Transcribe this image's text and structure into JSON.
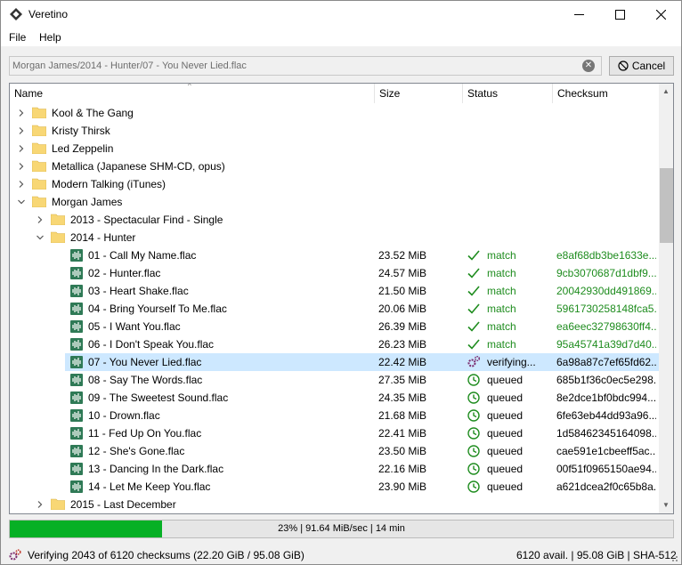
{
  "window": {
    "title": "Veretino"
  },
  "menu": {
    "file": "File",
    "help": "Help"
  },
  "path_bar": {
    "value": "Morgan James/2014 - Hunter/07 - You Never Lied.flac"
  },
  "cancel_button": {
    "label": "Cancel"
  },
  "columns": {
    "name": "Name",
    "size": "Size",
    "status": "Status",
    "checksum": "Checksum"
  },
  "tree_rows": [
    {
      "kind": "folder",
      "level": 0,
      "expander": "collapsed",
      "name": "Kool & The Gang"
    },
    {
      "kind": "folder",
      "level": 0,
      "expander": "collapsed",
      "name": "Kristy Thirsk"
    },
    {
      "kind": "folder",
      "level": 0,
      "expander": "collapsed",
      "name": "Led Zeppelin"
    },
    {
      "kind": "folder",
      "level": 0,
      "expander": "collapsed",
      "name": "Metallica (Japanese SHM-CD, opus)"
    },
    {
      "kind": "folder",
      "level": 0,
      "expander": "collapsed",
      "name": "Modern Talking (iTunes)"
    },
    {
      "kind": "folder",
      "level": 0,
      "expander": "expanded",
      "name": "Morgan James"
    },
    {
      "kind": "folder",
      "level": 1,
      "expander": "collapsed",
      "name": "2013 - Spectacular Find - Single"
    },
    {
      "kind": "folder",
      "level": 1,
      "expander": "expanded",
      "name": "2014 - Hunter"
    },
    {
      "kind": "file",
      "level": 2,
      "name": "01 - Call My Name.flac",
      "size": "23.52 MiB",
      "status": "match",
      "checksum": "e8af68db3be1633e..."
    },
    {
      "kind": "file",
      "level": 2,
      "name": "02 - Hunter.flac",
      "size": "24.57 MiB",
      "status": "match",
      "checksum": "9cb3070687d1dbf9..."
    },
    {
      "kind": "file",
      "level": 2,
      "name": "03 - Heart Shake.flac",
      "size": "21.50 MiB",
      "status": "match",
      "checksum": "20042930dd491869..."
    },
    {
      "kind": "file",
      "level": 2,
      "name": "04 - Bring Yourself To Me.flac",
      "size": "20.06 MiB",
      "status": "match",
      "checksum": "5961730258148fca5..."
    },
    {
      "kind": "file",
      "level": 2,
      "name": "05 - I Want You.flac",
      "size": "26.39 MiB",
      "status": "match",
      "checksum": "ea6eec32798630ff4..."
    },
    {
      "kind": "file",
      "level": 2,
      "name": "06 - I Don't Speak You.flac",
      "size": "26.23 MiB",
      "status": "match",
      "checksum": "95a45741a39d7d40..."
    },
    {
      "kind": "file",
      "level": 2,
      "name": "07 - You Never Lied.flac",
      "size": "22.42 MiB",
      "status": "verifying...",
      "checksum": "6a98a87c7ef65fd62...",
      "selected": true
    },
    {
      "kind": "file",
      "level": 2,
      "name": "08 - Say The Words.flac",
      "size": "27.35 MiB",
      "status": "queued",
      "checksum": "685b1f36c0ec5e298..."
    },
    {
      "kind": "file",
      "level": 2,
      "name": "09 - The Sweetest Sound.flac",
      "size": "24.35 MiB",
      "status": "queued",
      "checksum": "8e2dce1bf0bdc994..."
    },
    {
      "kind": "file",
      "level": 2,
      "name": "10 - Drown.flac",
      "size": "21.68 MiB",
      "status": "queued",
      "checksum": "6fe63eb44dd93a96..."
    },
    {
      "kind": "file",
      "level": 2,
      "name": "11 - Fed Up On You.flac",
      "size": "22.41 MiB",
      "status": "queued",
      "checksum": "1d58462345164098..."
    },
    {
      "kind": "file",
      "level": 2,
      "name": "12 - She's Gone.flac",
      "size": "23.50 MiB",
      "status": "queued",
      "checksum": "cae591e1cbeeff5ac..."
    },
    {
      "kind": "file",
      "level": 2,
      "name": "13 - Dancing In the Dark.flac",
      "size": "22.16 MiB",
      "status": "queued",
      "checksum": "00f51f0965150ae94..."
    },
    {
      "kind": "file",
      "level": 2,
      "name": "14 - Let Me Keep You.flac",
      "size": "23.90 MiB",
      "status": "queued",
      "checksum": "a621dcea2f0c65b8a..."
    },
    {
      "kind": "folder",
      "level": 1,
      "expander": "collapsed",
      "name": "2015 - Last December"
    }
  ],
  "progress": {
    "fraction": 0.23,
    "label": "23% | 91.64 MiB/sec | 14 min"
  },
  "statusbar": {
    "left": "Verifying 2043 of 6120 checksums (22.20 GiB / 95.08 GiB)",
    "right": "6120 avail. | 95.08 GiB | SHA-512"
  },
  "colors": {
    "match": "#1e8c1e",
    "progress": "#06b025",
    "selected": "#cde8ff",
    "folder": "#f8d775",
    "file_icon": "#2f7a56"
  },
  "icons": {
    "match": "check-icon",
    "verifying": "gears-icon",
    "queued": "clock-icon"
  }
}
